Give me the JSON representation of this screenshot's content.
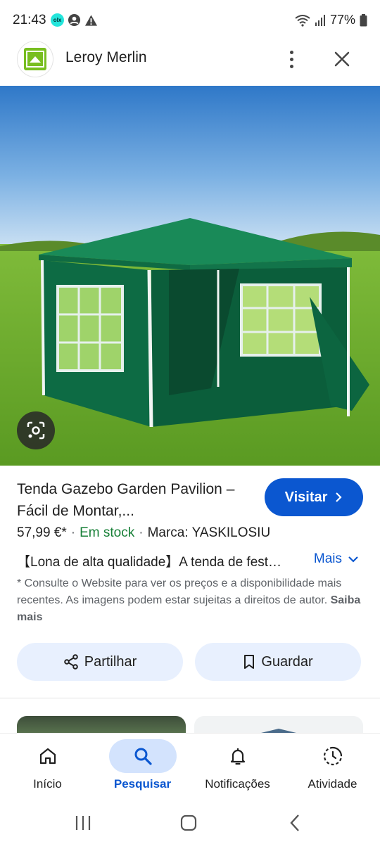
{
  "status_bar": {
    "time": "21:43",
    "battery": "77%",
    "icons": [
      "olx-icon",
      "account-icon",
      "alert-icon",
      "wifi-icon",
      "signal-icon",
      "battery-icon"
    ],
    "olx_text": "olx"
  },
  "header": {
    "site_name": "Leroy Merlin",
    "logo_icon": "leroy-merlin-logo"
  },
  "product": {
    "title": "Tenda Gazebo Garden Pavilion – Fácil de Montar,...",
    "visit_label": "Visitar",
    "price": "57,99 €*",
    "stock": "Em stock",
    "brand": "Marca: YASKILOSIU",
    "description": "【Lona de alta qualidade】A tenda de fest…",
    "more_label": "Mais",
    "disclaimer": "* Consulte o Website para ver os preços e a disponibilidade mais recentes. As imagens podem estar sujeitas a direitos de autor.",
    "learn_more": "Saiba mais"
  },
  "actions": {
    "share_label": "Partilhar",
    "save_label": "Guardar"
  },
  "bottom_nav": {
    "items": [
      {
        "label": "Início",
        "icon": "home-icon"
      },
      {
        "label": "Pesquisar",
        "icon": "search-icon",
        "active": true
      },
      {
        "label": "Notificações",
        "icon": "bell-icon"
      },
      {
        "label": "Atividade",
        "icon": "activity-icon"
      }
    ]
  },
  "colors": {
    "accent": "#0b57d0",
    "stock_green": "#188038",
    "tent_green": "#0e6b45",
    "brand_green": "#78be20"
  }
}
